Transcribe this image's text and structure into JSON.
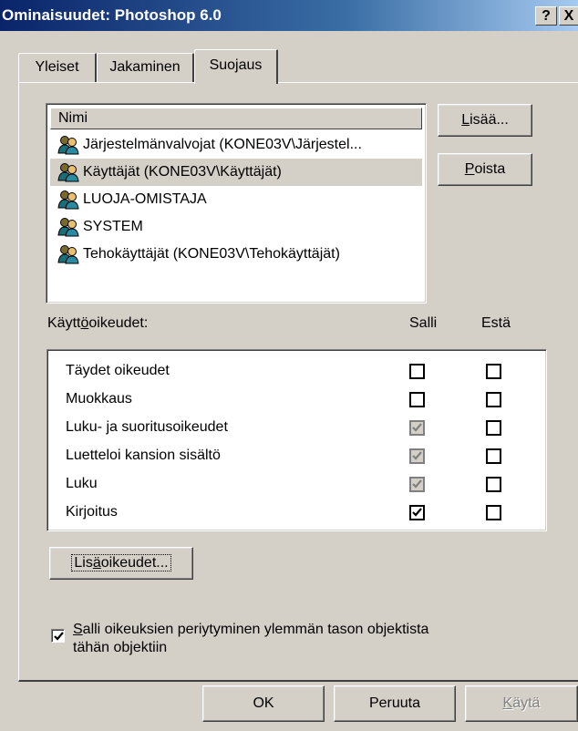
{
  "window": {
    "title": "Ominaisuudet: Photoshop 6.0",
    "help_label": "?",
    "close_label": "X"
  },
  "tabs": [
    {
      "label": "Yleiset"
    },
    {
      "label": "Jakaminen"
    },
    {
      "label": "Suojaus"
    }
  ],
  "names_list": {
    "header": "Nimi",
    "items": [
      {
        "label": "Järjestelmänvalvojat (KONE03V\\Järjestel...",
        "icon": "users-group-icon"
      },
      {
        "label": "Käyttäjät (KONE03V\\Käyttäjät)",
        "icon": "users-group-icon",
        "selected": true
      },
      {
        "label": "LUOJA-OMISTAJA",
        "icon": "users-group-icon"
      },
      {
        "label": "SYSTEM",
        "icon": "users-group-icon"
      },
      {
        "label": "Tehokäyttäjät (KONE03V\\Tehokäyttäjät)",
        "icon": "users-group-icon"
      }
    ]
  },
  "buttons": {
    "add": {
      "pre": "",
      "key": "L",
      "post": "isää..."
    },
    "remove": {
      "pre": "",
      "key": "P",
      "post": "oista"
    },
    "advanced": {
      "pre": "Lis",
      "key": "ä",
      "post": "oikeudet..."
    },
    "ok": "OK",
    "cancel": "Peruuta",
    "apply": {
      "pre": "",
      "key": "K",
      "post": "äytä"
    }
  },
  "permissions": {
    "label": {
      "pre": "Käytt",
      "key": "ö",
      "post": "oikeudet:"
    },
    "allow_header": "Salli",
    "deny_header": "Estä",
    "rows": [
      {
        "name": "Täydet oikeudet",
        "allow": "unchecked",
        "deny": "unchecked"
      },
      {
        "name": "Muokkaus",
        "allow": "unchecked",
        "deny": "unchecked"
      },
      {
        "name": "Luku- ja suoritusoikeudet",
        "allow": "checked-grey",
        "deny": "unchecked"
      },
      {
        "name": "Luetteloi kansion sisältö",
        "allow": "checked-grey",
        "deny": "unchecked"
      },
      {
        "name": "Luku",
        "allow": "checked-grey",
        "deny": "unchecked"
      },
      {
        "name": "Kirjoitus",
        "allow": "checked",
        "deny": "unchecked"
      }
    ]
  },
  "inherit": {
    "checked": true,
    "line1_key": "S",
    "line1_rest": "alli oikeuksien periytyminen ylemmän tason objektista",
    "line2": "tähän objektiin"
  }
}
